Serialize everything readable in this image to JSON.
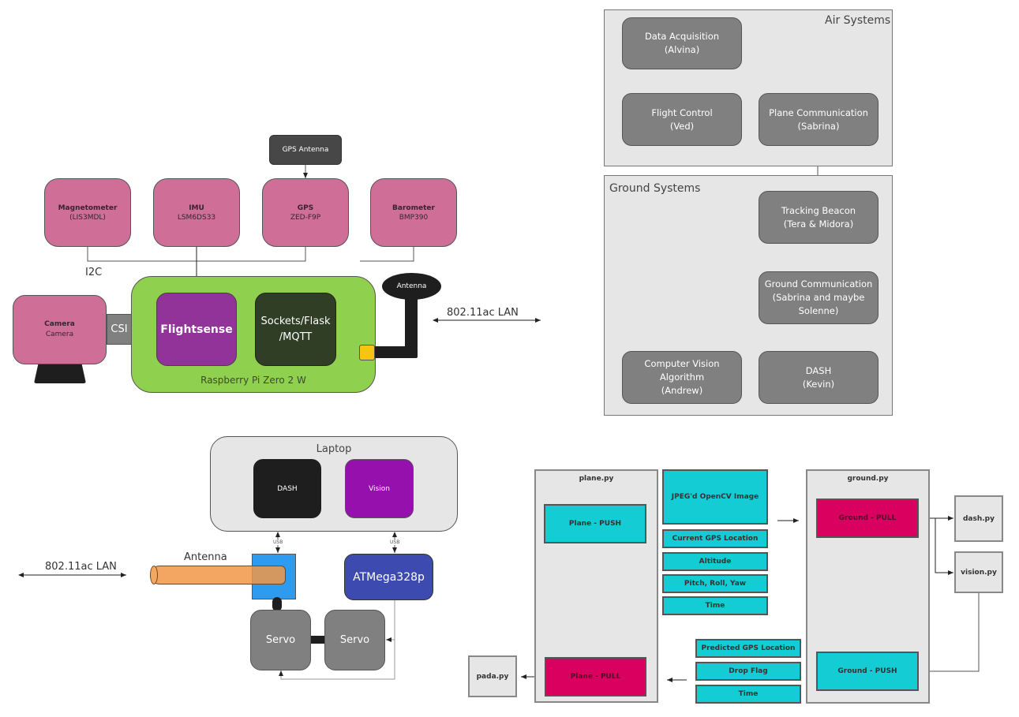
{
  "hardware": {
    "sensors": [
      {
        "name": "Magnetometer",
        "part": "(LIS3MDL)"
      },
      {
        "name": "IMU",
        "part": "LSM6DS33"
      },
      {
        "name": "GPS",
        "part": "ZED-F9P"
      },
      {
        "name": "Barometer",
        "part": "BMP390"
      }
    ],
    "gps_antenna": "GPS Antenna",
    "bus_label": "I2C",
    "camera": {
      "name": "Camera",
      "part": "Camera"
    },
    "csi_label": "CSI",
    "board_label": "Raspberry Pi Zero 2 W",
    "flightsense": "Flightsense",
    "sockets_line1": "Sockets/Flask",
    "sockets_line2": "/MQTT",
    "antenna": "Antenna",
    "link_label": "802.11ac LAN"
  },
  "teams": {
    "air": {
      "title": "Air Systems",
      "boxes": [
        {
          "line1": "Data Acquisition",
          "line2": "(Alvina)"
        },
        {
          "line1": "Flight Control",
          "line2": "(Ved)"
        },
        {
          "line1": "Plane Communication",
          "line2": "(Sabrina)"
        }
      ]
    },
    "ground": {
      "title": "Ground Systems",
      "boxes": [
        {
          "line1": "Tracking Beacon",
          "line2": "(Tera & Midora)"
        },
        {
          "line1": "Ground Communication",
          "line2": "(Sabrina and maybe",
          "line3": "Solenne)"
        },
        {
          "line1": "Computer Vision",
          "line2": "Algorithm",
          "line3": "(Andrew)"
        },
        {
          "line1": "DASH",
          "line2": "(Kevin)"
        }
      ]
    }
  },
  "ground_station": {
    "laptop_label": "Laptop",
    "dash": "DASH",
    "vision": "Vision",
    "usb_label": "USB",
    "antenna_label": "Antenna",
    "link_label": "802.11ac LAN",
    "mcu": "ATMega328p",
    "servo": "Servo"
  },
  "software": {
    "plane": {
      "title": "plane.py",
      "push": "Plane - PUSH",
      "pull": "Plane - PULL"
    },
    "ground": {
      "title": "ground.py",
      "pull": "Ground - PULL",
      "push": "Ground - PUSH"
    },
    "uplink_fields": [
      "JPEG'd OpenCV Image",
      "Current GPS Location",
      "Altitude",
      "Pitch, Roll, Yaw",
      "Time"
    ],
    "downlink_fields": [
      "Predicted GPS Location",
      "Drop Flag",
      "Time"
    ],
    "files": {
      "pada": "pada.py",
      "dash": "dash.py",
      "vision": "vision.py"
    }
  },
  "colors": {
    "sensor": "#cf6f98",
    "board": "#8fd14f",
    "flightsense": "#913399",
    "team_box": "#808080",
    "cyan": "#13ccd4",
    "magenta": "#d9005f",
    "atmega": "#3d4bb0"
  }
}
